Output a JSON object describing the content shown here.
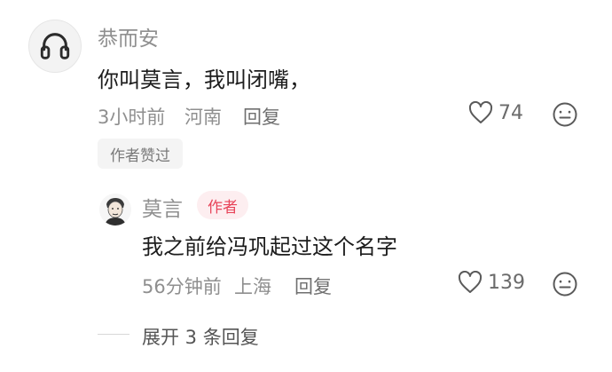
{
  "comment": {
    "username": "恭而安",
    "text": "你叫莫言，我叫闭嘴，",
    "time": "3小时前",
    "location": "河南",
    "reply_label": "回复",
    "like_count": "74",
    "liked_by_author_badge": "作者赞过"
  },
  "reply": {
    "username": "莫言",
    "author_tag": "作者",
    "text": "我之前给冯巩起过这个名字",
    "time": "56分钟前",
    "location": "上海",
    "reply_label": "回复",
    "like_count": "139"
  },
  "expand_replies": "展开 3 条回复",
  "colors": {
    "meta_gray": "#8f8f8f",
    "author_tag_red": "#e8455a",
    "author_tag_bg": "#fdeef0",
    "badge_bg": "#f4f4f4"
  },
  "icons": [
    "headphones-icon",
    "heart-icon",
    "emoji-face-icon"
  ]
}
